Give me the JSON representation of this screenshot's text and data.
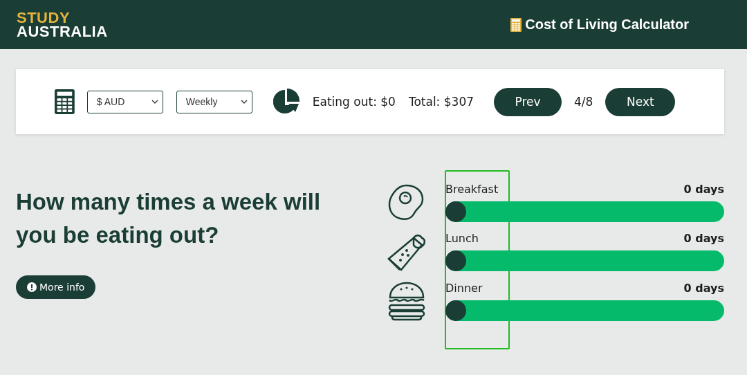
{
  "header": {
    "logo_top": "STUDY",
    "logo_bottom": "AUSTRALIA",
    "title": "Cost of Living Calculator"
  },
  "toolbar": {
    "currency": "$ AUD",
    "period": "Weekly",
    "category_total": "Eating out: $0",
    "total": "Total: $307",
    "prev": "Prev",
    "step": "4/8",
    "next": "Next"
  },
  "question": {
    "heading": "How many times a week will you be eating out?",
    "more_info": "More info"
  },
  "meals": [
    {
      "kind": "egg",
      "label": "Breakfast",
      "reading": "0 days",
      "level": 0
    },
    {
      "kind": "wrap",
      "label": "Lunch",
      "reading": "0 days",
      "level": 0
    },
    {
      "kind": "burger",
      "label": "Dinner",
      "reading": "0 days",
      "level": 0
    }
  ]
}
